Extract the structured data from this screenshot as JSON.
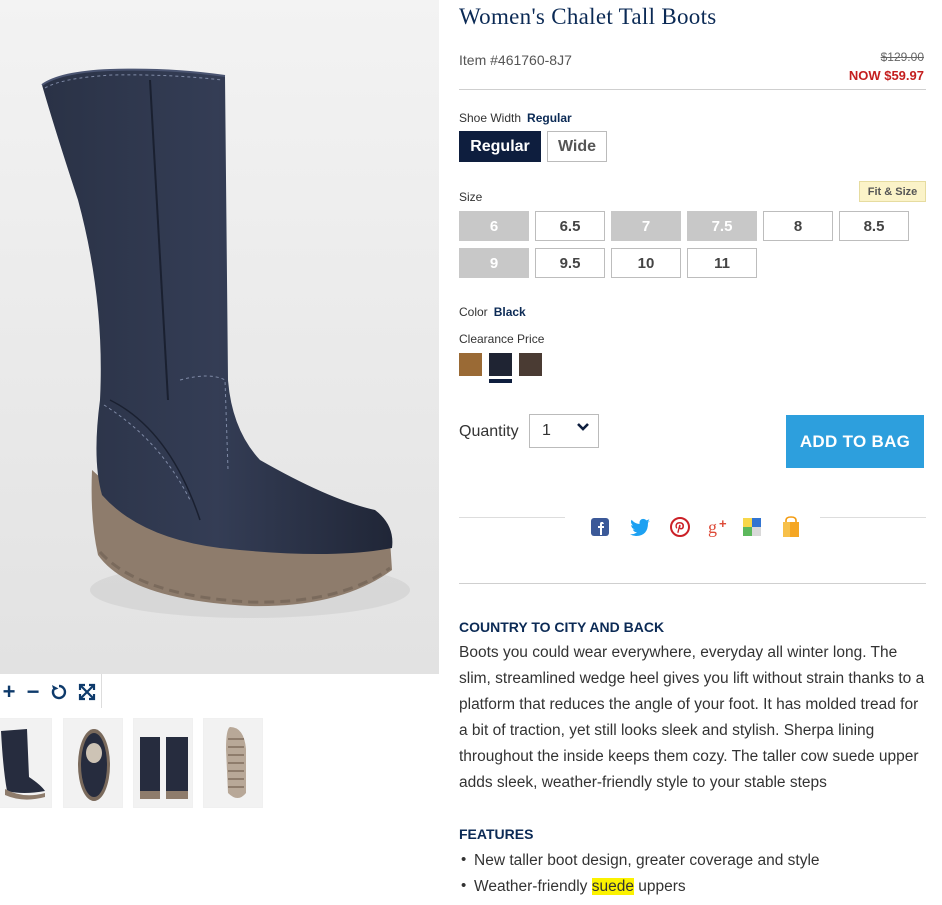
{
  "product": {
    "title": "Women's Chalet Tall Boots",
    "item_number": "Item #461760-8J7",
    "was_price": "$129.00",
    "now_price": "NOW $59.97"
  },
  "shoe_width": {
    "label": "Shoe Width",
    "selected": "Regular",
    "options": [
      "Regular",
      "Wide"
    ]
  },
  "size": {
    "label": "Size",
    "fit_link": "Fit & Size",
    "options": [
      {
        "label": "6",
        "available": false
      },
      {
        "label": "6.5",
        "available": true
      },
      {
        "label": "7",
        "available": false
      },
      {
        "label": "7.5",
        "available": false
      },
      {
        "label": "8",
        "available": true
      },
      {
        "label": "8.5",
        "available": true
      },
      {
        "label": "9",
        "available": false
      },
      {
        "label": "9.5",
        "available": true
      },
      {
        "label": "10",
        "available": true
      },
      {
        "label": "11",
        "available": true
      }
    ]
  },
  "color": {
    "label": "Color",
    "selected": "Black",
    "group_label": "Clearance Price",
    "swatches": [
      "#9a6a35",
      "#1f2433",
      "#4a3b33"
    ]
  },
  "quantity": {
    "label": "Quantity",
    "value": "1"
  },
  "add_to_bag": "ADD TO BAG",
  "social_icons": [
    "facebook-icon",
    "twitter-icon",
    "pinterest-icon",
    "google-plus-icon",
    "delicious-icon",
    "shopping-bag-icon"
  ],
  "description": {
    "heading": "COUNTRY TO CITY AND BACK",
    "body": "Boots you could wear everywhere, everyday all winter long. The slim, streamlined wedge heel gives you lift without strain thanks to a platform that reduces the angle of your foot. It has molded tread for a bit of traction, yet still looks sleek and stylish. Sherpa lining throughout the inside keeps them cozy. The taller cow suede upper adds sleek, weather-friendly style to your stable steps"
  },
  "features": {
    "heading": "FEATURES",
    "items": [
      {
        "before": "New taller boot design, greater coverage and style",
        "highlight": "",
        "after": ""
      },
      {
        "before": "Weather-friendly ",
        "highlight": "suede",
        "after": " uppers"
      }
    ]
  },
  "image_controls": [
    "zoom-in-icon",
    "zoom-out-icon",
    "rotate-icon",
    "fullscreen-icon"
  ],
  "colors": {
    "navy": "#0b2a55",
    "sale_red": "#c41e1e",
    "add_bag_blue": "#2d9fdd"
  }
}
